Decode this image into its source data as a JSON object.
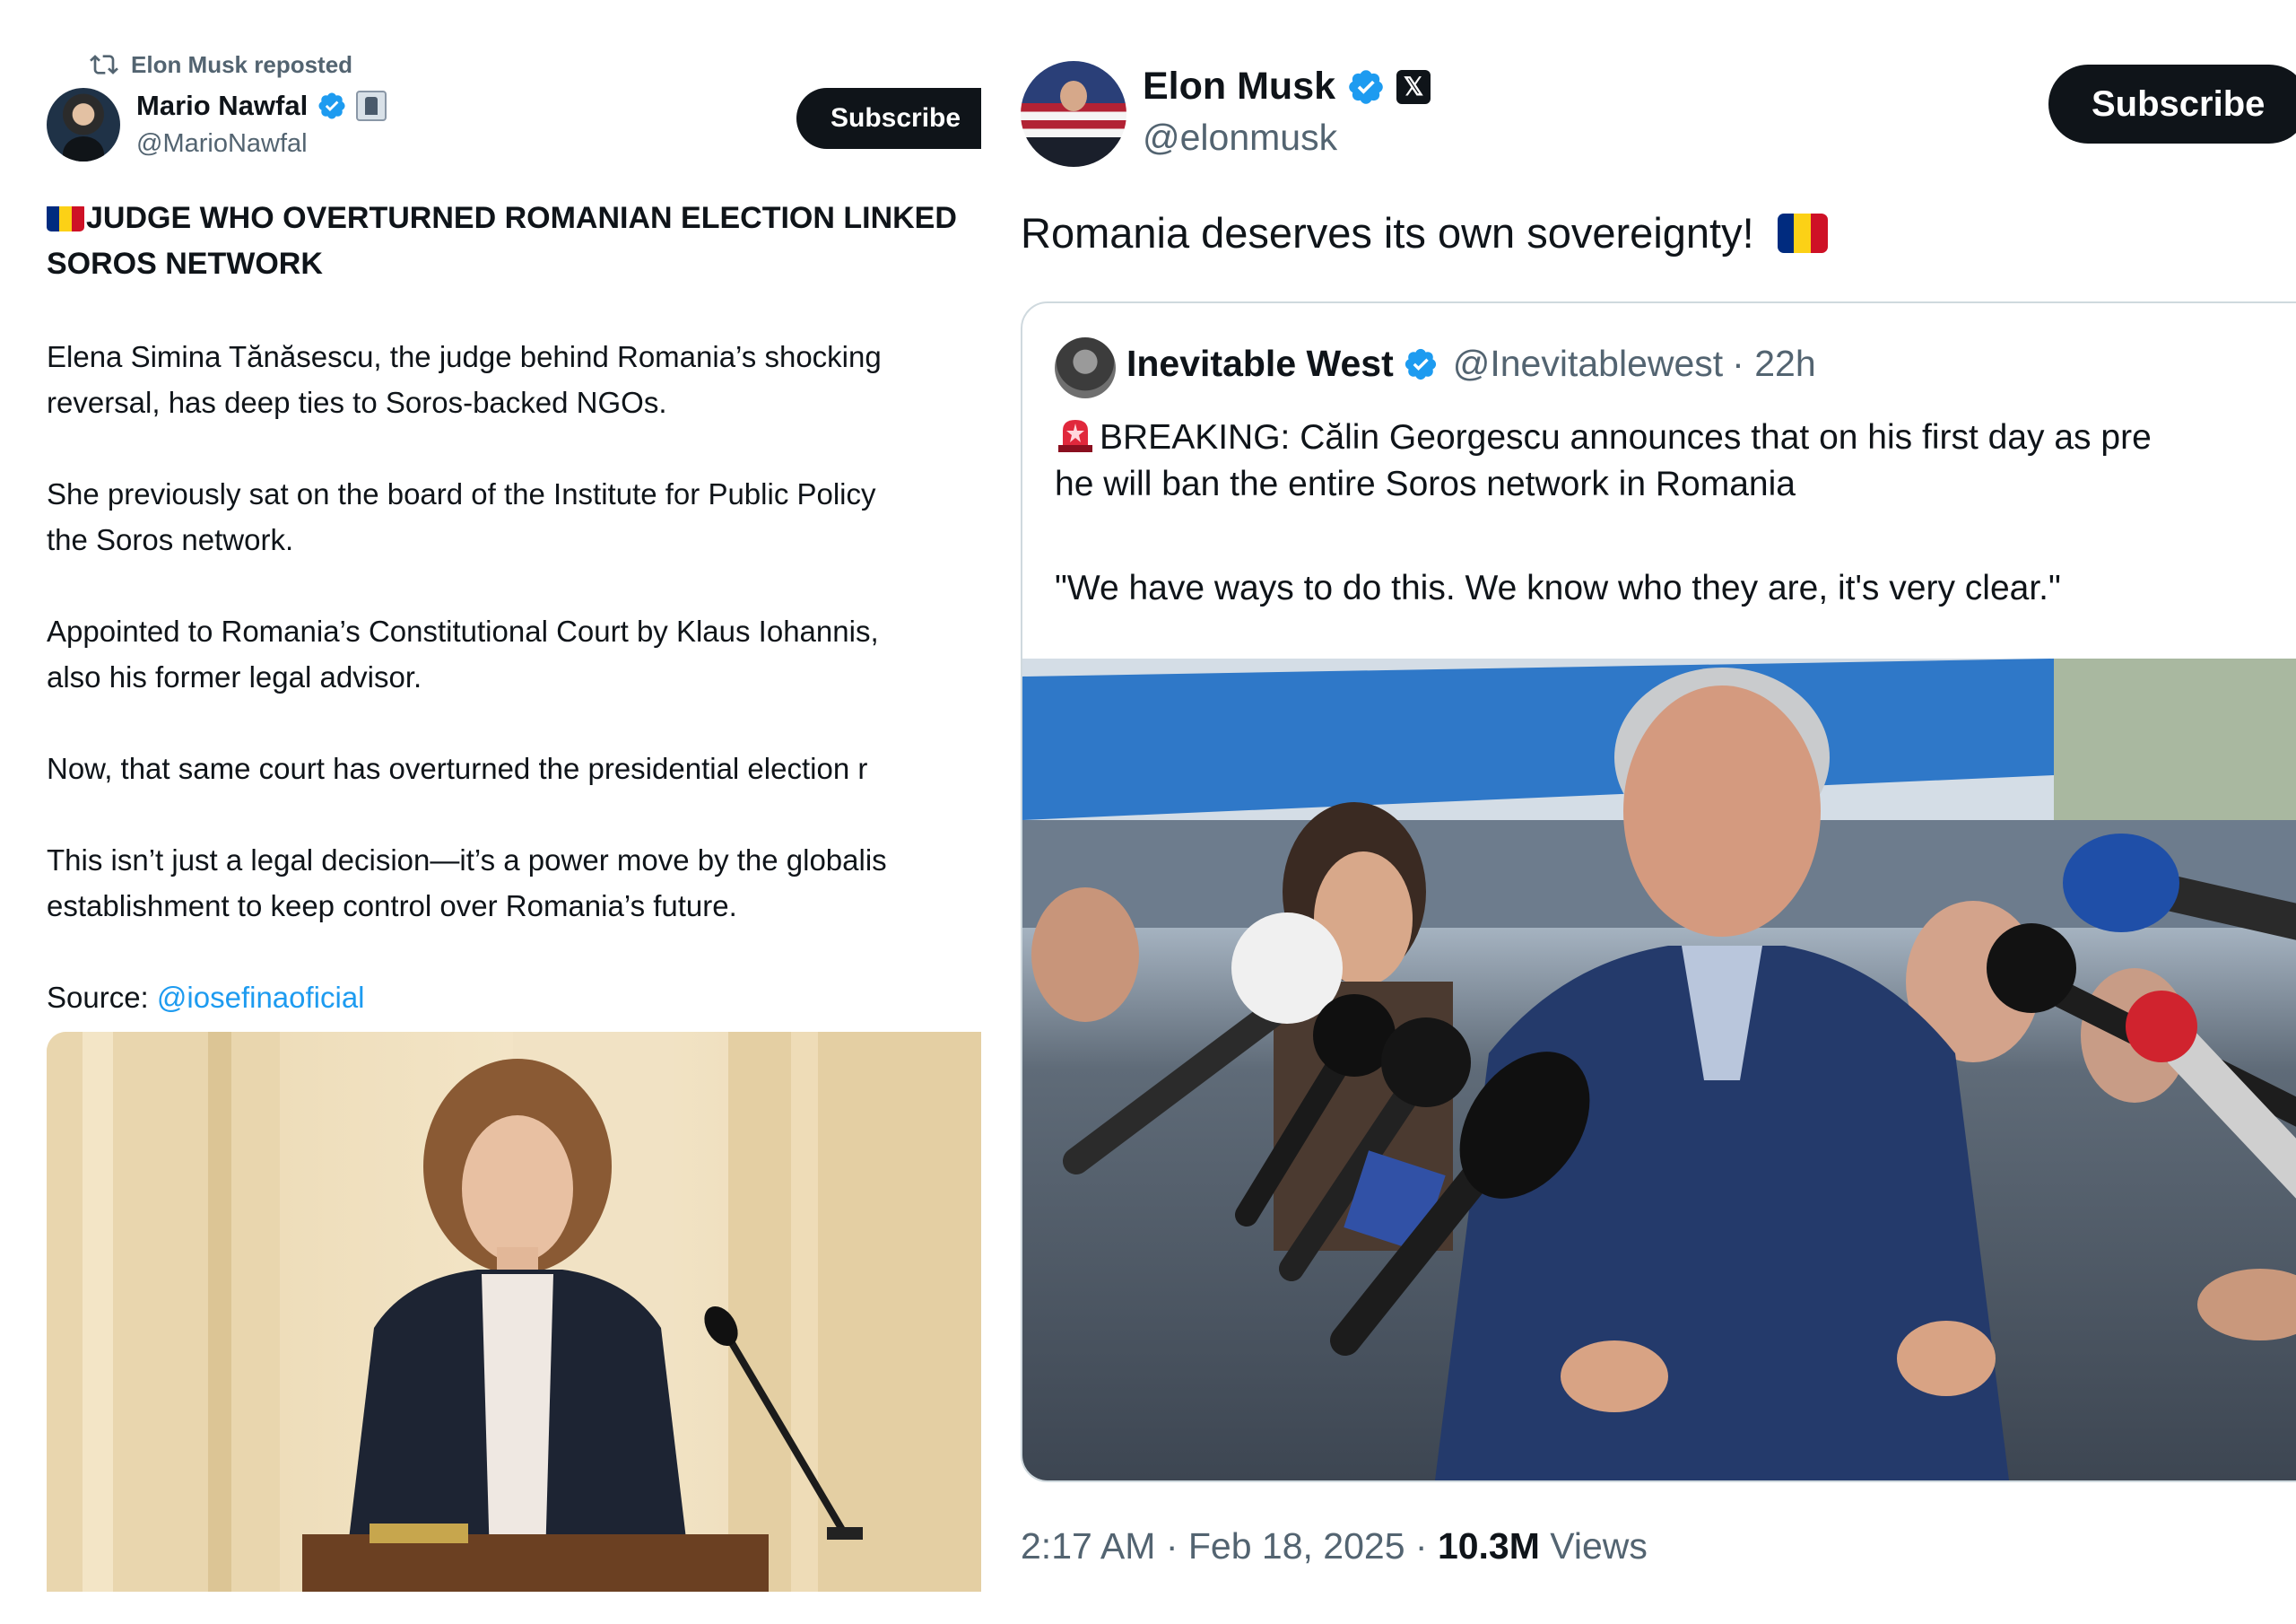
{
  "left_post": {
    "repost_text": "Elon Musk reposted",
    "author_name": "Mario Nawfal",
    "author_handle": "@MarioNawfal",
    "subscribe_label": "Subscribe",
    "headline_line1": "JUDGE WHO OVERTURNED ROMANIAN ELECTION LINKED",
    "headline_line2": "SOROS NETWORK",
    "paragraphs": [
      "Elena Simina Tănăsescu, the judge behind Romania’s shocking",
      "reversal, has deep ties to Soros-backed NGOs.",
      "She previously sat on the board of the Institute for Public Policy",
      "the Soros network.",
      "Appointed to Romania’s Constitutional Court by Klaus Iohannis,",
      "also his former legal advisor.",
      "Now, that same court has overturned the presidential election r",
      "This isn’t just a legal decision—it’s a power move by the globalis",
      "establishment to keep control over Romania’s future."
    ],
    "source_label": "Source: ",
    "source_link": "@iosefinaoficial"
  },
  "right_post": {
    "author_name": "Elon Musk",
    "author_handle": "@elonmusk",
    "x_badge": "𝕏",
    "subscribe_label": "Subscribe",
    "text": "Romania deserves its own sovereignty!",
    "quoted": {
      "author_name": "Inevitable West",
      "author_handle": "@Inevitablewest",
      "time": "· 22h",
      "line1": "BREAKING: Călin Georgescu announces that on his first day as pre",
      "line2": "he will ban the entire Soros network in Romania",
      "line3": "\"We have ways to do this. We know who they are, it's very clear.\""
    },
    "timestamp": "2:17 AM · Feb 18, 2025 · ",
    "views_count": "10.3M",
    "views_label": " Views"
  },
  "colors": {
    "link": "#1d9bf0",
    "verified": "#1d9bf0",
    "romania_blue": "#002b7f",
    "romania_yellow": "#fcd116",
    "romania_red": "#ce1126"
  },
  "icons": [
    "repost-icon",
    "verified-badge-icon",
    "affiliate-badge-icon",
    "x-logo-icon",
    "romania-flag-icon",
    "siren-icon"
  ]
}
